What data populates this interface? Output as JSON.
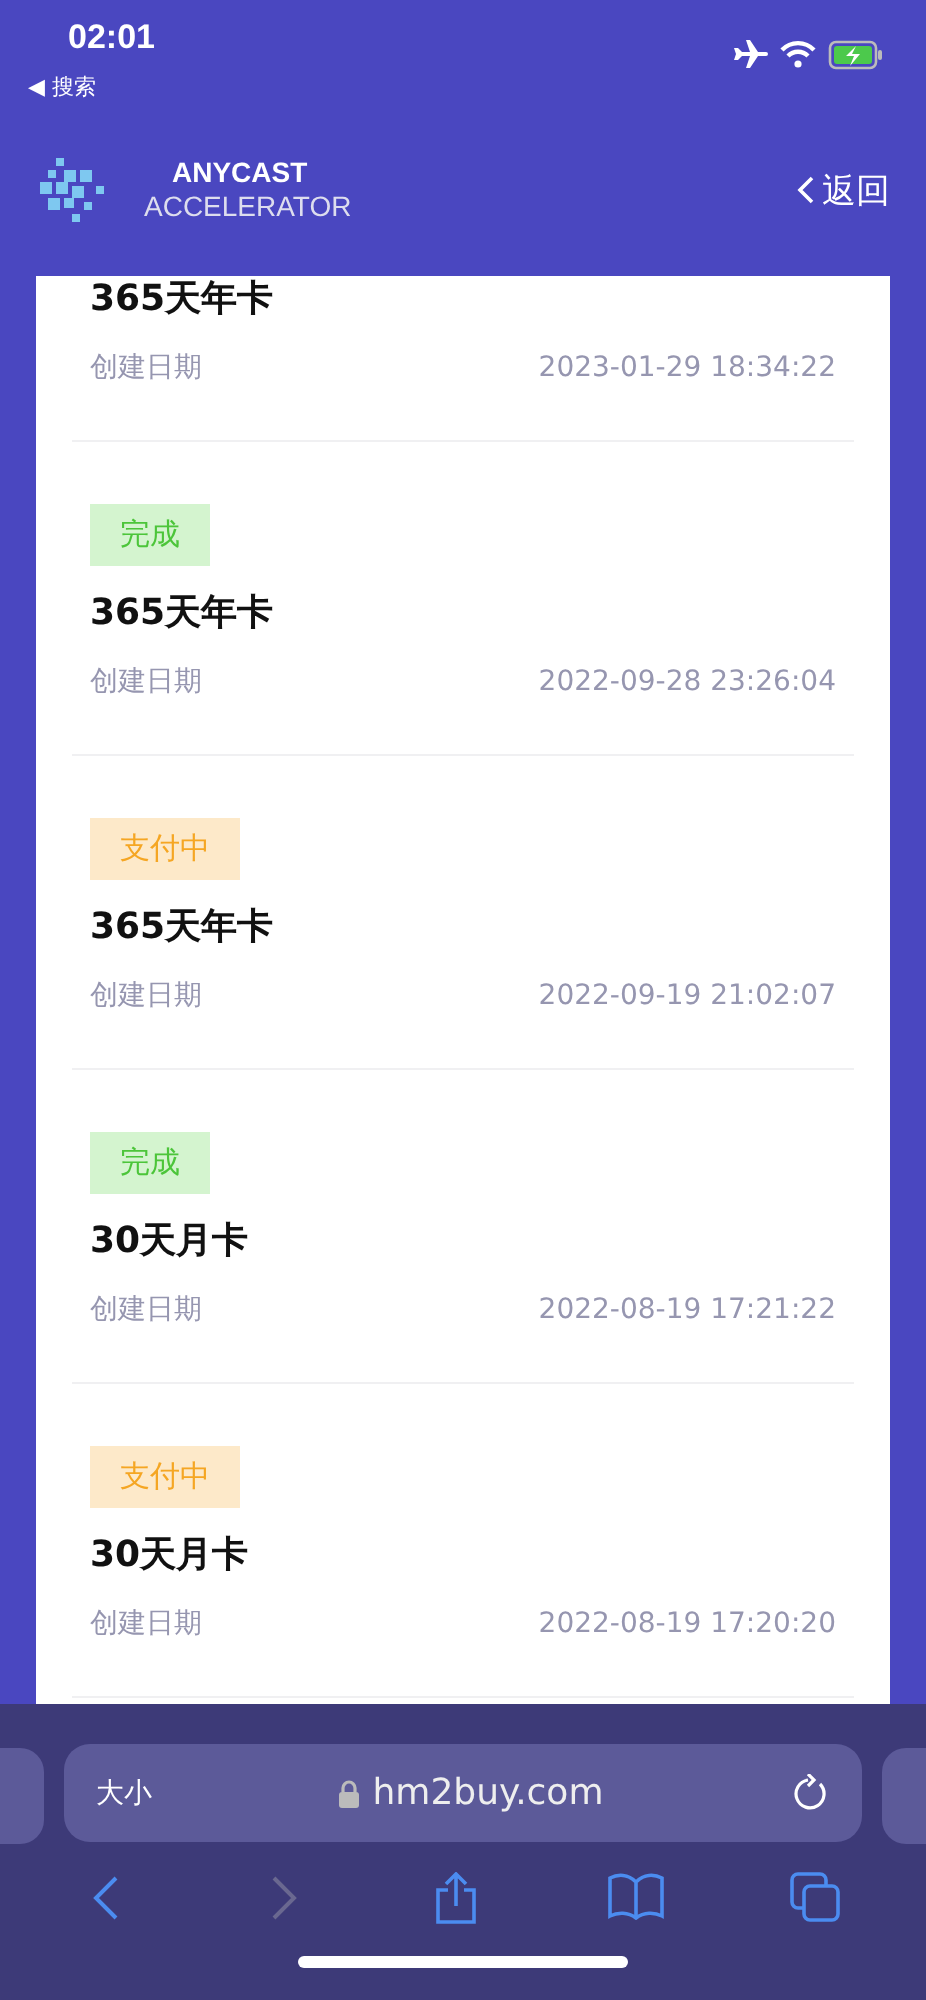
{
  "status_bar": {
    "time": "02:01",
    "back_label": "◀ 搜索"
  },
  "header": {
    "logo_line1": "ANYCAST",
    "logo_line2": "ACCELERATOR",
    "back": "返回"
  },
  "orders": [
    {
      "title": "365天年卡",
      "date_label": "创建日期",
      "date": "2023-01-29 18:34:22"
    },
    {
      "status": {
        "label": "完成",
        "kind": "done"
      },
      "title": "365天年卡",
      "date_label": "创建日期",
      "date": "2022-09-28 23:26:04"
    },
    {
      "status": {
        "label": "支付中",
        "kind": "paying"
      },
      "title": "365天年卡",
      "date_label": "创建日期",
      "date": "2022-09-19 21:02:07"
    },
    {
      "status": {
        "label": "完成",
        "kind": "done"
      },
      "title": "30天月卡",
      "date_label": "创建日期",
      "date": "2022-08-19 17:21:22"
    },
    {
      "status": {
        "label": "支付中",
        "kind": "paying"
      },
      "title": "30天月卡",
      "date_label": "创建日期",
      "date": "2022-08-19 17:20:20"
    }
  ],
  "browser": {
    "text_size": "大小",
    "url": "hm2buy.com"
  }
}
